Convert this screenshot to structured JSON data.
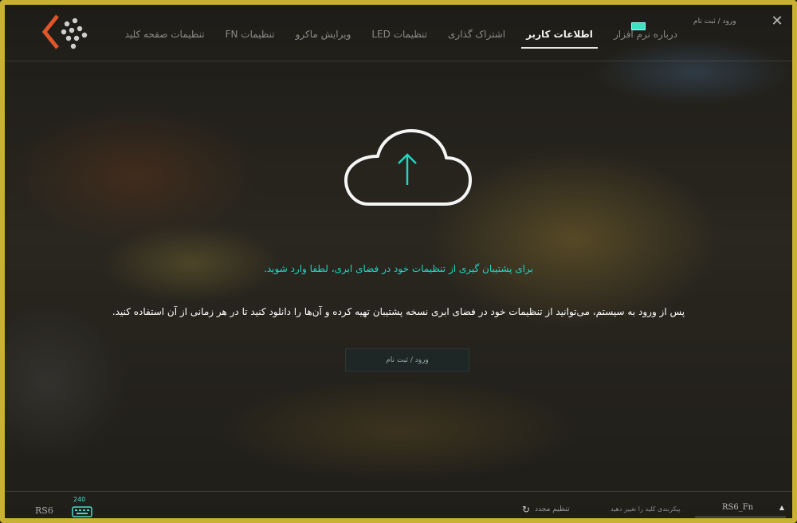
{
  "header": {
    "close_glyph": "✕",
    "signin_link": "ورود / ثبت نام",
    "tabs": [
      {
        "label": "درباره نرم افزار",
        "active": false
      },
      {
        "label": "اطلاعات کاربر",
        "active": true
      },
      {
        "label": "اشتراک گذاری",
        "active": false
      },
      {
        "label": "LED تنظیمات",
        "active": false
      },
      {
        "label": "ویرایش ماکرو",
        "active": false
      },
      {
        "label": "FN تنظیمات",
        "active": false
      },
      {
        "label": "تنظیمات صفحه کلید",
        "active": false
      }
    ]
  },
  "main": {
    "icon": "cloud-upload-icon",
    "message_primary": "برای پشتیبان گیری از تنظیمات خود در فضای ابری، لطفا وارد شوید.",
    "message_secondary": "پس از ورود به سیستم، می‌توانید از تنظیمات خود در فضای ابری نسخه پشتیبان تهیه کرده و آن‌ها را دانلود کنید تا در هر زمانی از آن استفاده کنید.",
    "login_button": "ورود / ثبت نام"
  },
  "footer": {
    "model": "RS6",
    "keyboard_count": "240",
    "reset_label": "تنظیم مجدد",
    "change_key_label": "پیکربندی کلید را تغییر دهید",
    "layer_value": "RS6_Fn"
  },
  "colors": {
    "accent": "#1fd6c3",
    "frame": "#c9b233",
    "logo_orange": "#e0562a"
  }
}
